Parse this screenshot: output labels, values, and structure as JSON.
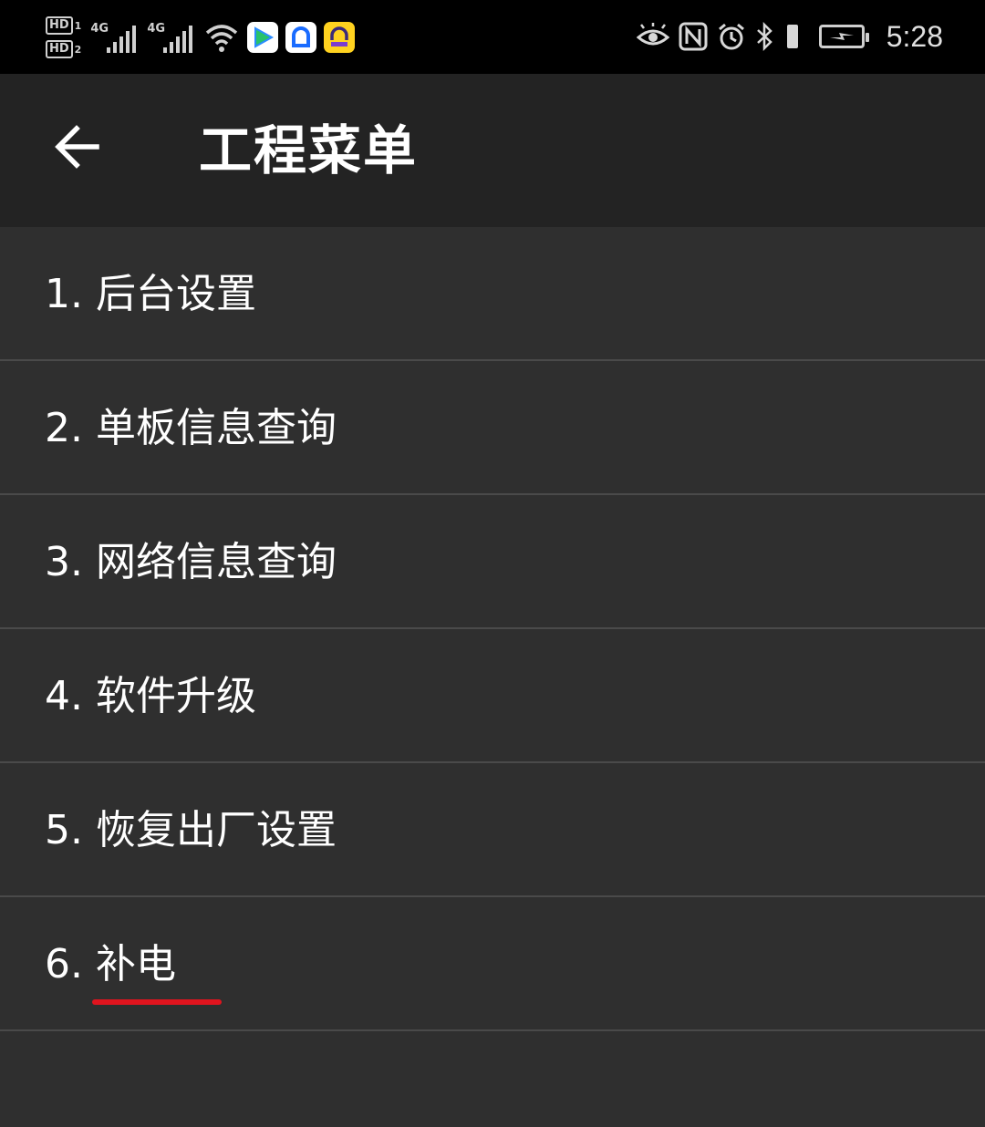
{
  "status_bar": {
    "sim1_label": "HD",
    "sim1_num": "1",
    "sim2_label": "HD",
    "sim2_num": "2",
    "network1": "4G",
    "network2": "4G",
    "time": "5:28",
    "icons": [
      "eye-comfort-icon",
      "nfc-icon",
      "alarm-icon",
      "bluetooth-icon",
      "vibrate-icon",
      "battery-charging-icon"
    ],
    "notification_apps": [
      "video-app-icon",
      "chat-app-icon",
      "car-app-icon"
    ]
  },
  "header": {
    "title": "工程菜单",
    "back_icon": "arrow-left-icon"
  },
  "menu": {
    "items": [
      {
        "label": "1. 后台设置"
      },
      {
        "label": "2. 单板信息查询"
      },
      {
        "label": "3. 网络信息查询"
      },
      {
        "label": "4. 软件升级"
      },
      {
        "label": "5. 恢复出厂设置"
      },
      {
        "label": "6. 补电"
      }
    ]
  },
  "colors": {
    "status_bar_bg": "#000000",
    "app_bar_bg": "#232323",
    "list_bg": "#2f2f2f",
    "divider": "#4a4a4a",
    "highlight_underline": "#e0141e"
  }
}
